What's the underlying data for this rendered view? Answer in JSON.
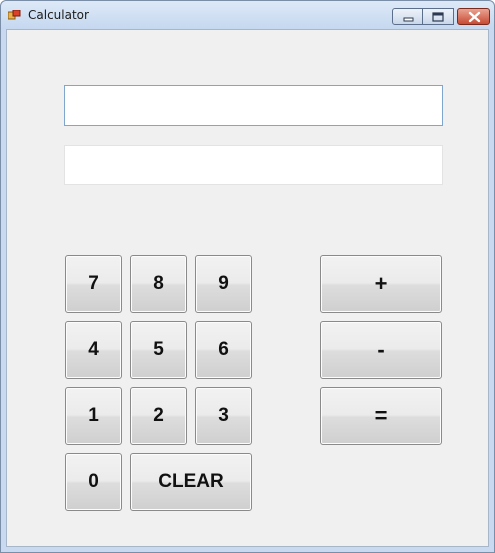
{
  "window": {
    "title": "Calculator"
  },
  "display": {
    "primary_value": "",
    "secondary_value": ""
  },
  "keypad": {
    "seven": "7",
    "eight": "8",
    "nine": "9",
    "four": "4",
    "five": "5",
    "six": "6",
    "one": "1",
    "two": "2",
    "three": "3",
    "zero": "0",
    "clear": "CLEAR"
  },
  "operators": {
    "plus": "+",
    "minus": "-",
    "equals": "="
  },
  "icons": {
    "app": "calculator-app-icon",
    "minimize": "minimize-icon",
    "maximize": "maximize-icon",
    "close": "close-icon"
  },
  "colors": {
    "close_button": "#c94a32",
    "titlebar": "#c9daf0",
    "client_bg": "#f0f0f0"
  }
}
